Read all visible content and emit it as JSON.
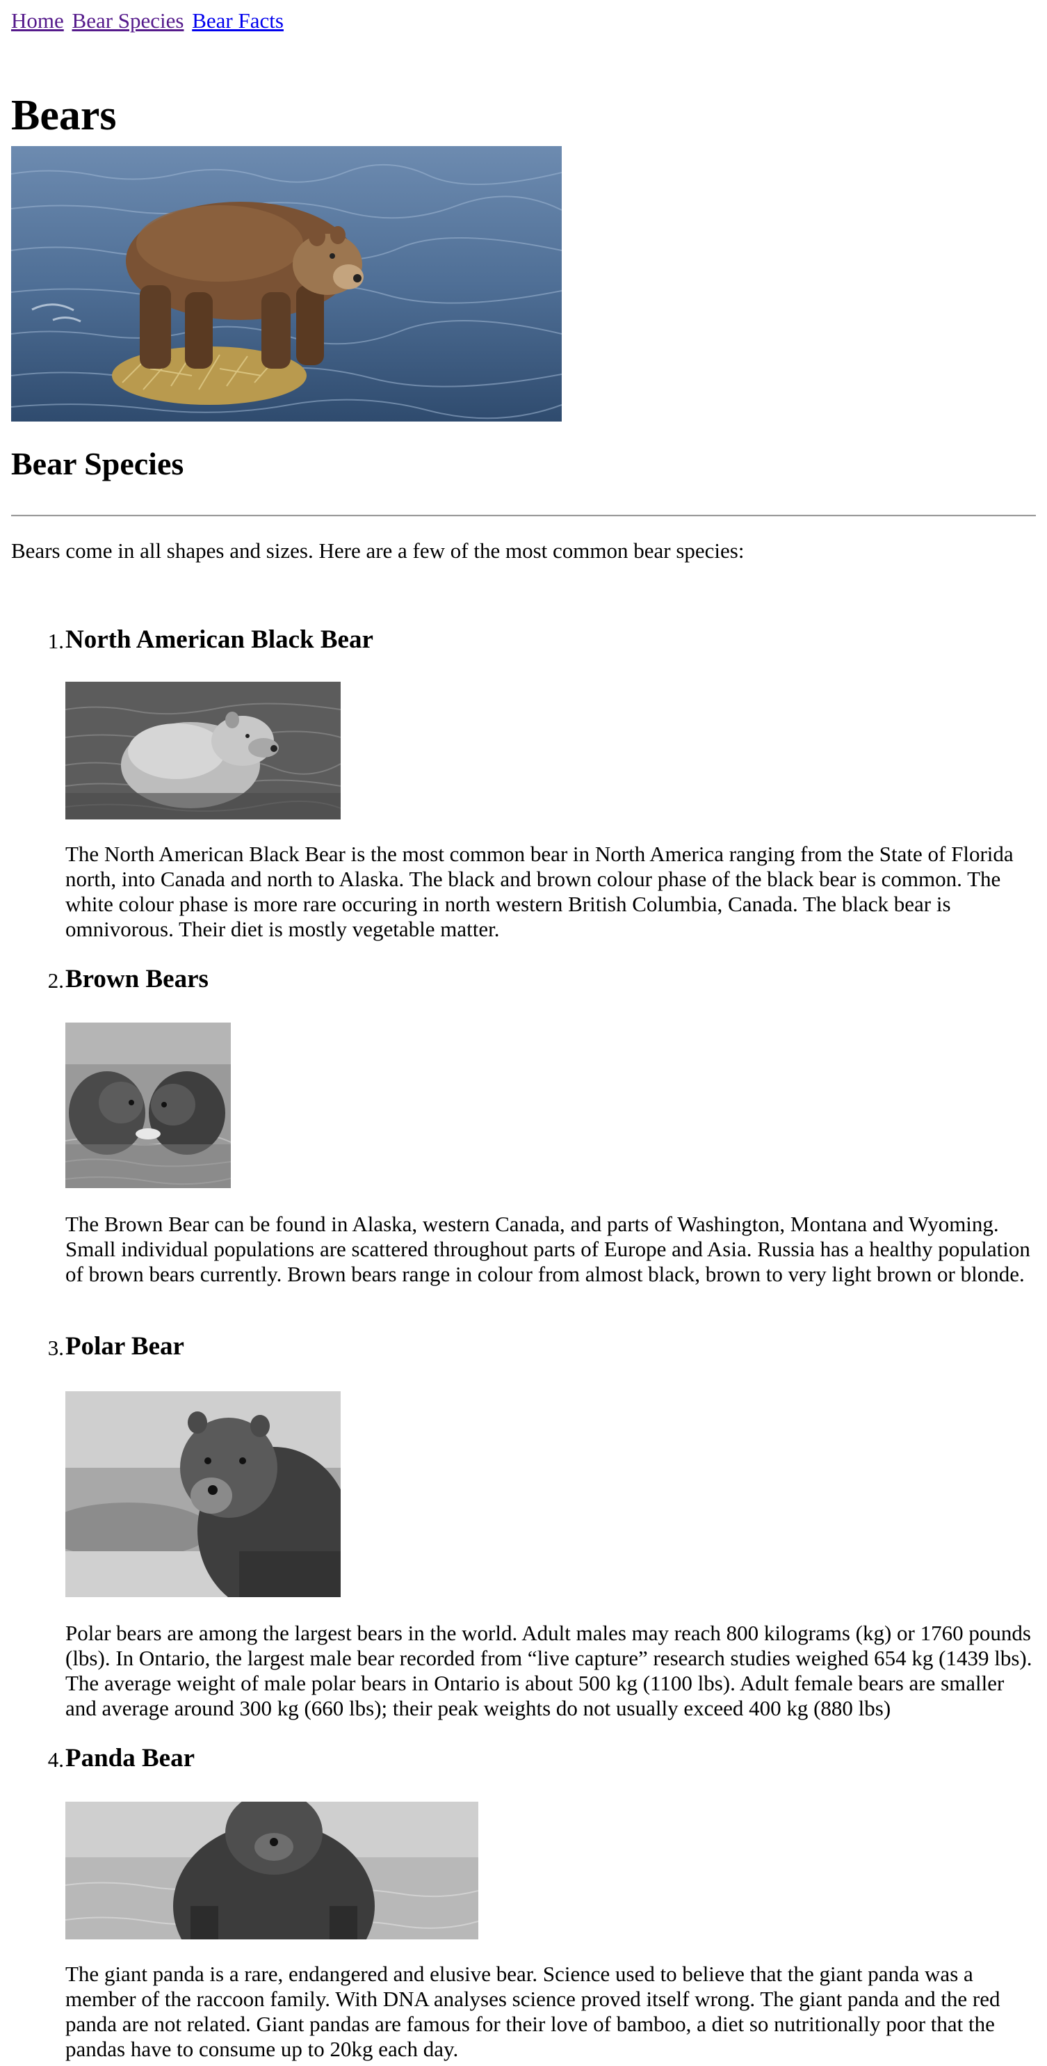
{
  "nav": {
    "links": [
      "Home",
      "Bear Species",
      "Bear Facts"
    ]
  },
  "page_title": "Bears",
  "section_title": "Bear Species",
  "intro": "Bears come in all shapes and sizes. Here are a few of the most common bear species:",
  "species": [
    {
      "number": "1.",
      "name": "North American Black Bear",
      "description": "The North American Black Bear is the most common bear in North America ranging from the State of Florida north, into Canada and north to Alaska. The black and brown colour phase of the black bear is common. The white colour phase is more rare occuring in north western British Columbia, Canada. The black bear is omnivorous. Their diet is mostly vegetable matter."
    },
    {
      "number": "2.",
      "name": "Brown Bears",
      "description": "The Brown Bear can be found in Alaska, western Canada, and parts of Washington, Montana and Wyoming. Small individual populations are scattered throughout parts of Europe and Asia. Russia has a healthy population of brown bears currently. Brown bears range in colour from almost black, brown to very light brown or blonde."
    },
    {
      "number": "3.",
      "name": "Polar Bear",
      "description": "Polar bears are among the largest bears in the world. Adult males may reach 800 kilograms (kg) or 1760 pounds (lbs). In Ontario, the largest male bear recorded from “live capture” research studies weighed 654 kg (1439 lbs). The average weight of male polar bears in Ontario is about 500 kg (1100 lbs). Adult female bears are smaller and average around 300 kg (660 lbs); their peak weights do not usually exceed 400 kg (880 lbs)"
    },
    {
      "number": "4.",
      "name": "Panda Bear",
      "description": "The giant panda is a rare, endangered and elusive bear. Science used to believe that the giant panda was a member of the raccoon family. With DNA analyses science proved itself wrong. The giant panda and the red panda are not related. Giant pandas are famous for their love of bamboo, a diet so nutritionally poor that the pandas have to consume up to 20kg each day."
    }
  ],
  "colors": {
    "visited_link": "#551a8b",
    "unvisited_link": "#0000ee",
    "water": "#4f6f96",
    "bear_brown": "#7a5234"
  }
}
